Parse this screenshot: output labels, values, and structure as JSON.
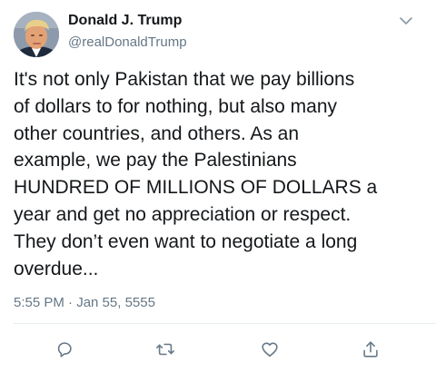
{
  "author": {
    "display_name": "Donald J. Trump",
    "handle": "@realDonaldTrump"
  },
  "tweet": {
    "lines": [
      "It's not only Pakistan that we pay billions",
      "of dollars to for nothing, but also many",
      "other countries, and others. As an",
      "example, we pay the Palestinians",
      "HUNDRED OF MILLIONS OF DOLLARS a",
      "year and get no appreciation or respect.",
      "They don’t even want to negotiate a long",
      "overdue..."
    ],
    "timestamp": "5:55 PM · Jan 55, 5555"
  },
  "actions": {
    "icons": [
      "reply-icon",
      "retweet-icon",
      "like-icon",
      "share-icon"
    ]
  },
  "colors": {
    "text_primary": "#14171a",
    "text_secondary": "#657786",
    "icon": "#657786",
    "divider": "#e6ecf0"
  }
}
